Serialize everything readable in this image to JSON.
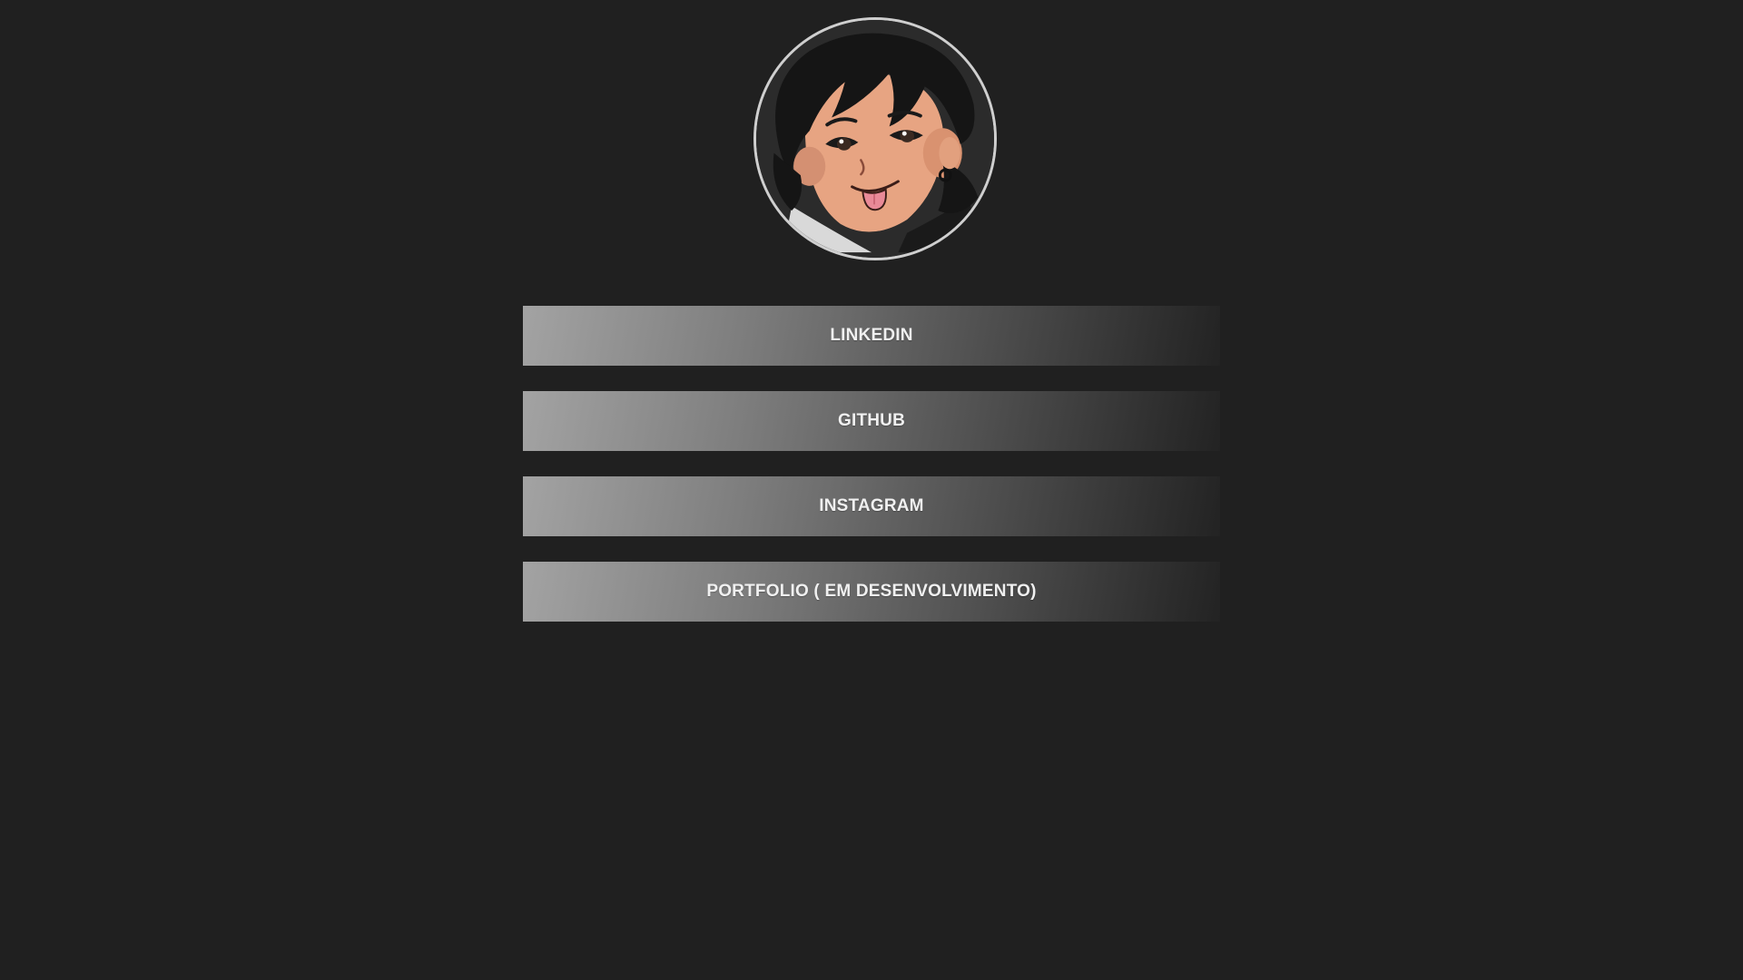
{
  "profile": {
    "avatar_icon": "cartoon-face-avatar"
  },
  "links": [
    {
      "label": "LINKEDIN"
    },
    {
      "label": "GITHUB"
    },
    {
      "label": "INSTAGRAM"
    },
    {
      "label": "PORTFOLIO ( EM DESENVOLVIMENTO)"
    }
  ],
  "colors": {
    "background": "#202020",
    "button_light": "#a3a3a3",
    "button_dark": "#232323",
    "text": "#f0f0f0",
    "avatar_border": "#cfcfcf"
  }
}
